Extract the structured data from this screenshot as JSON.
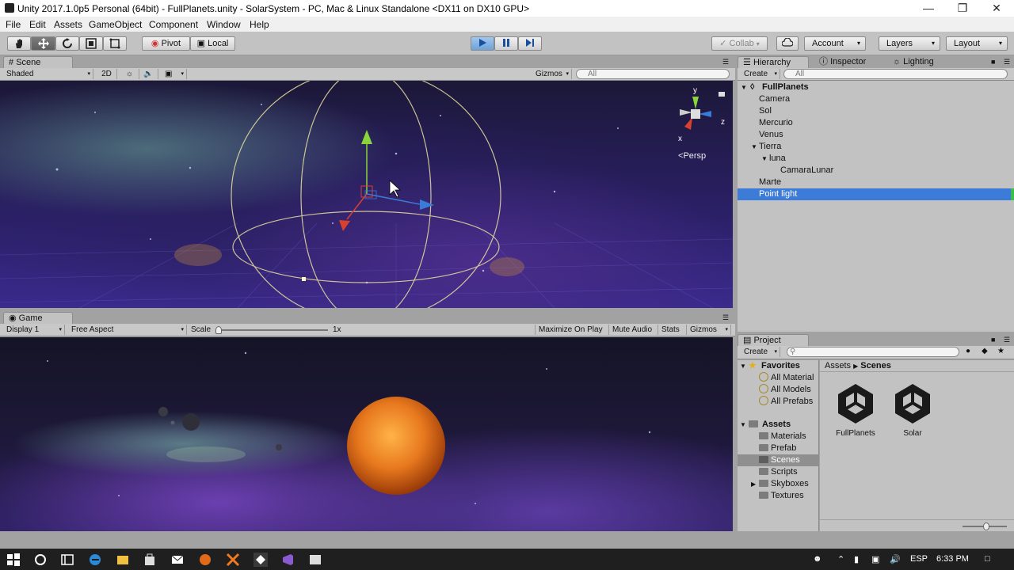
{
  "window": {
    "title": "Unity 2017.1.0p5 Personal (64bit) - FullPlanets.unity - SolarSystem - PC, Mac & Linux Standalone <DX11 on DX10 GPU>",
    "controls": [
      "minimize-icon",
      "maximize-icon",
      "close-icon"
    ]
  },
  "menu": [
    "File",
    "Edit",
    "Assets",
    "GameObject",
    "Component",
    "Window",
    "Help"
  ],
  "toolbar": {
    "pivot_label": "Pivot",
    "local_label": "Local",
    "collab_label": "Collab",
    "account_label": "Account",
    "layers_label": "Layers",
    "layout_label": "Layout"
  },
  "scene": {
    "tab_label": "Scene",
    "shading_mode": "Shaded",
    "mode_2d": "2D",
    "gizmos_label": "Gizmos",
    "search_placeholder": "All",
    "persp_label": "Persp",
    "axis_y": "y",
    "axis_z": "z",
    "axis_x": "x"
  },
  "game": {
    "tab_label": "Game",
    "display": "Display 1",
    "aspect": "Free Aspect",
    "scale_label": "Scale",
    "scale_value": "1x",
    "maximize_label": "Maximize On Play",
    "mute_label": "Mute Audio",
    "stats_label": "Stats",
    "gizmos_label": "Gizmos"
  },
  "hierarchy": {
    "tabs": [
      "Hierarchy",
      "Inspector",
      "Lighting"
    ],
    "create_label": "Create",
    "search_placeholder": "All",
    "scene_name": "FullPlanets",
    "items": [
      {
        "label": "Camera"
      },
      {
        "label": "Sol"
      },
      {
        "label": "Mercurio"
      },
      {
        "label": "Venus"
      },
      {
        "label": "Tierra"
      },
      {
        "label": "luna"
      },
      {
        "label": "CamaraLunar"
      },
      {
        "label": "Marte"
      },
      {
        "label": "Point light",
        "selected": true
      }
    ]
  },
  "project": {
    "tab_label": "Project",
    "create_label": "Create",
    "favorites_label": "Favorites",
    "favorites": [
      "All Material",
      "All Models",
      "All Prefabs"
    ],
    "assets_label": "Assets",
    "folders": [
      "Materials",
      "Prefab",
      "Scenes",
      "Scripts",
      "Skyboxes",
      "Textures"
    ],
    "selected_folder": "Scenes",
    "breadcrumb": [
      "Assets",
      "Scenes"
    ],
    "files": [
      "FullPlanets",
      "Solar"
    ]
  },
  "taskbar": {
    "language": "ESP",
    "time": "6:33 PM"
  },
  "colors": {
    "selection": "#3d7bd8",
    "play_button": "#6ea2d8",
    "panel": "#c2c2c2"
  }
}
